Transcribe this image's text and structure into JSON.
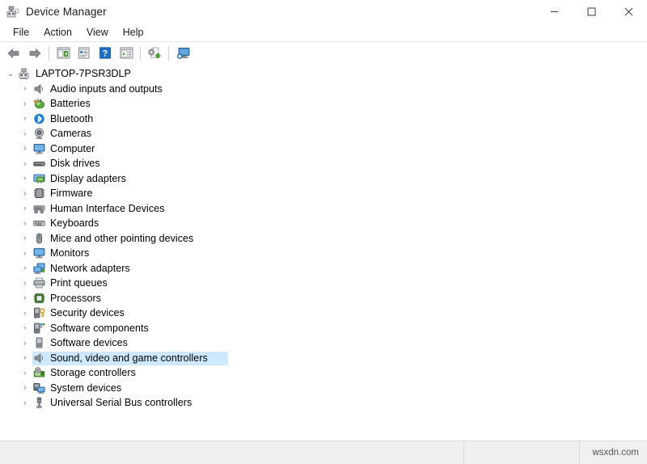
{
  "window": {
    "title": "Device Manager",
    "icon": "device-manager-icon",
    "controls": {
      "minimize": "–",
      "maximize": "□",
      "close": "✕"
    }
  },
  "menubar": {
    "items": [
      {
        "label": "File"
      },
      {
        "label": "Action"
      },
      {
        "label": "View"
      },
      {
        "label": "Help"
      }
    ]
  },
  "toolbar": {
    "buttons": [
      {
        "name": "back-button",
        "icon": "back-arrow-icon",
        "tooltip": "Back"
      },
      {
        "name": "forward-button",
        "icon": "forward-arrow-icon",
        "tooltip": "Forward"
      },
      {
        "name": "separator-1",
        "icon": "separator"
      },
      {
        "name": "show-console-tree-button",
        "icon": "console-tree-icon",
        "tooltip": "Show/Hide Console Tree"
      },
      {
        "name": "properties-button",
        "icon": "properties-icon",
        "tooltip": "Properties"
      },
      {
        "name": "help-button",
        "icon": "help-icon",
        "tooltip": "Help"
      },
      {
        "name": "show-action-pane-button",
        "icon": "action-pane-icon",
        "tooltip": "Show/Hide Action Pane"
      },
      {
        "name": "separator-2",
        "icon": "separator"
      },
      {
        "name": "update-driver-button",
        "icon": "update-driver-icon",
        "tooltip": "Update Driver Software"
      },
      {
        "name": "separator-3",
        "icon": "separator"
      },
      {
        "name": "scan-hardware-button",
        "icon": "scan-hardware-icon",
        "tooltip": "Scan for hardware changes"
      }
    ]
  },
  "tree": {
    "root": {
      "label": "LAPTOP-7PSR3DLP",
      "icon": "computer-root-icon",
      "expanded": true,
      "chevron": "⌄"
    },
    "collapsed_chevron": "›",
    "selection_color": "#cde8ff",
    "items": [
      {
        "label": "Audio inputs and outputs",
        "icon": "speaker-icon",
        "selected": false
      },
      {
        "label": "Batteries",
        "icon": "battery-icon",
        "selected": false
      },
      {
        "label": "Bluetooth",
        "icon": "bluetooth-icon",
        "selected": false
      },
      {
        "label": "Cameras",
        "icon": "camera-icon",
        "selected": false
      },
      {
        "label": "Computer",
        "icon": "monitor-icon",
        "selected": false
      },
      {
        "label": "Disk drives",
        "icon": "disk-drive-icon",
        "selected": false
      },
      {
        "label": "Display adapters",
        "icon": "display-adapter-icon",
        "selected": false
      },
      {
        "label": "Firmware",
        "icon": "firmware-chip-icon",
        "selected": false
      },
      {
        "label": "Human Interface Devices",
        "icon": "hid-icon",
        "selected": false
      },
      {
        "label": "Keyboards",
        "icon": "keyboard-icon",
        "selected": false
      },
      {
        "label": "Mice and other pointing devices",
        "icon": "mouse-icon",
        "selected": false
      },
      {
        "label": "Monitors",
        "icon": "monitor-icon",
        "selected": false
      },
      {
        "label": "Network adapters",
        "icon": "network-adapter-icon",
        "selected": false
      },
      {
        "label": "Print queues",
        "icon": "printer-icon",
        "selected": false
      },
      {
        "label": "Processors",
        "icon": "processor-icon",
        "selected": false
      },
      {
        "label": "Security devices",
        "icon": "security-device-icon",
        "selected": false
      },
      {
        "label": "Software components",
        "icon": "software-component-icon",
        "selected": false
      },
      {
        "label": "Software devices",
        "icon": "software-device-icon",
        "selected": false
      },
      {
        "label": "Sound, video and game controllers",
        "icon": "speaker-icon",
        "selected": true
      },
      {
        "label": "Storage controllers",
        "icon": "storage-controller-icon",
        "selected": false
      },
      {
        "label": "System devices",
        "icon": "system-device-icon",
        "selected": false
      },
      {
        "label": "Universal Serial Bus controllers",
        "icon": "usb-icon",
        "selected": false
      }
    ]
  },
  "statusbar": {
    "segment1": "",
    "segment2": "",
    "watermark": "wsxdn.com"
  }
}
